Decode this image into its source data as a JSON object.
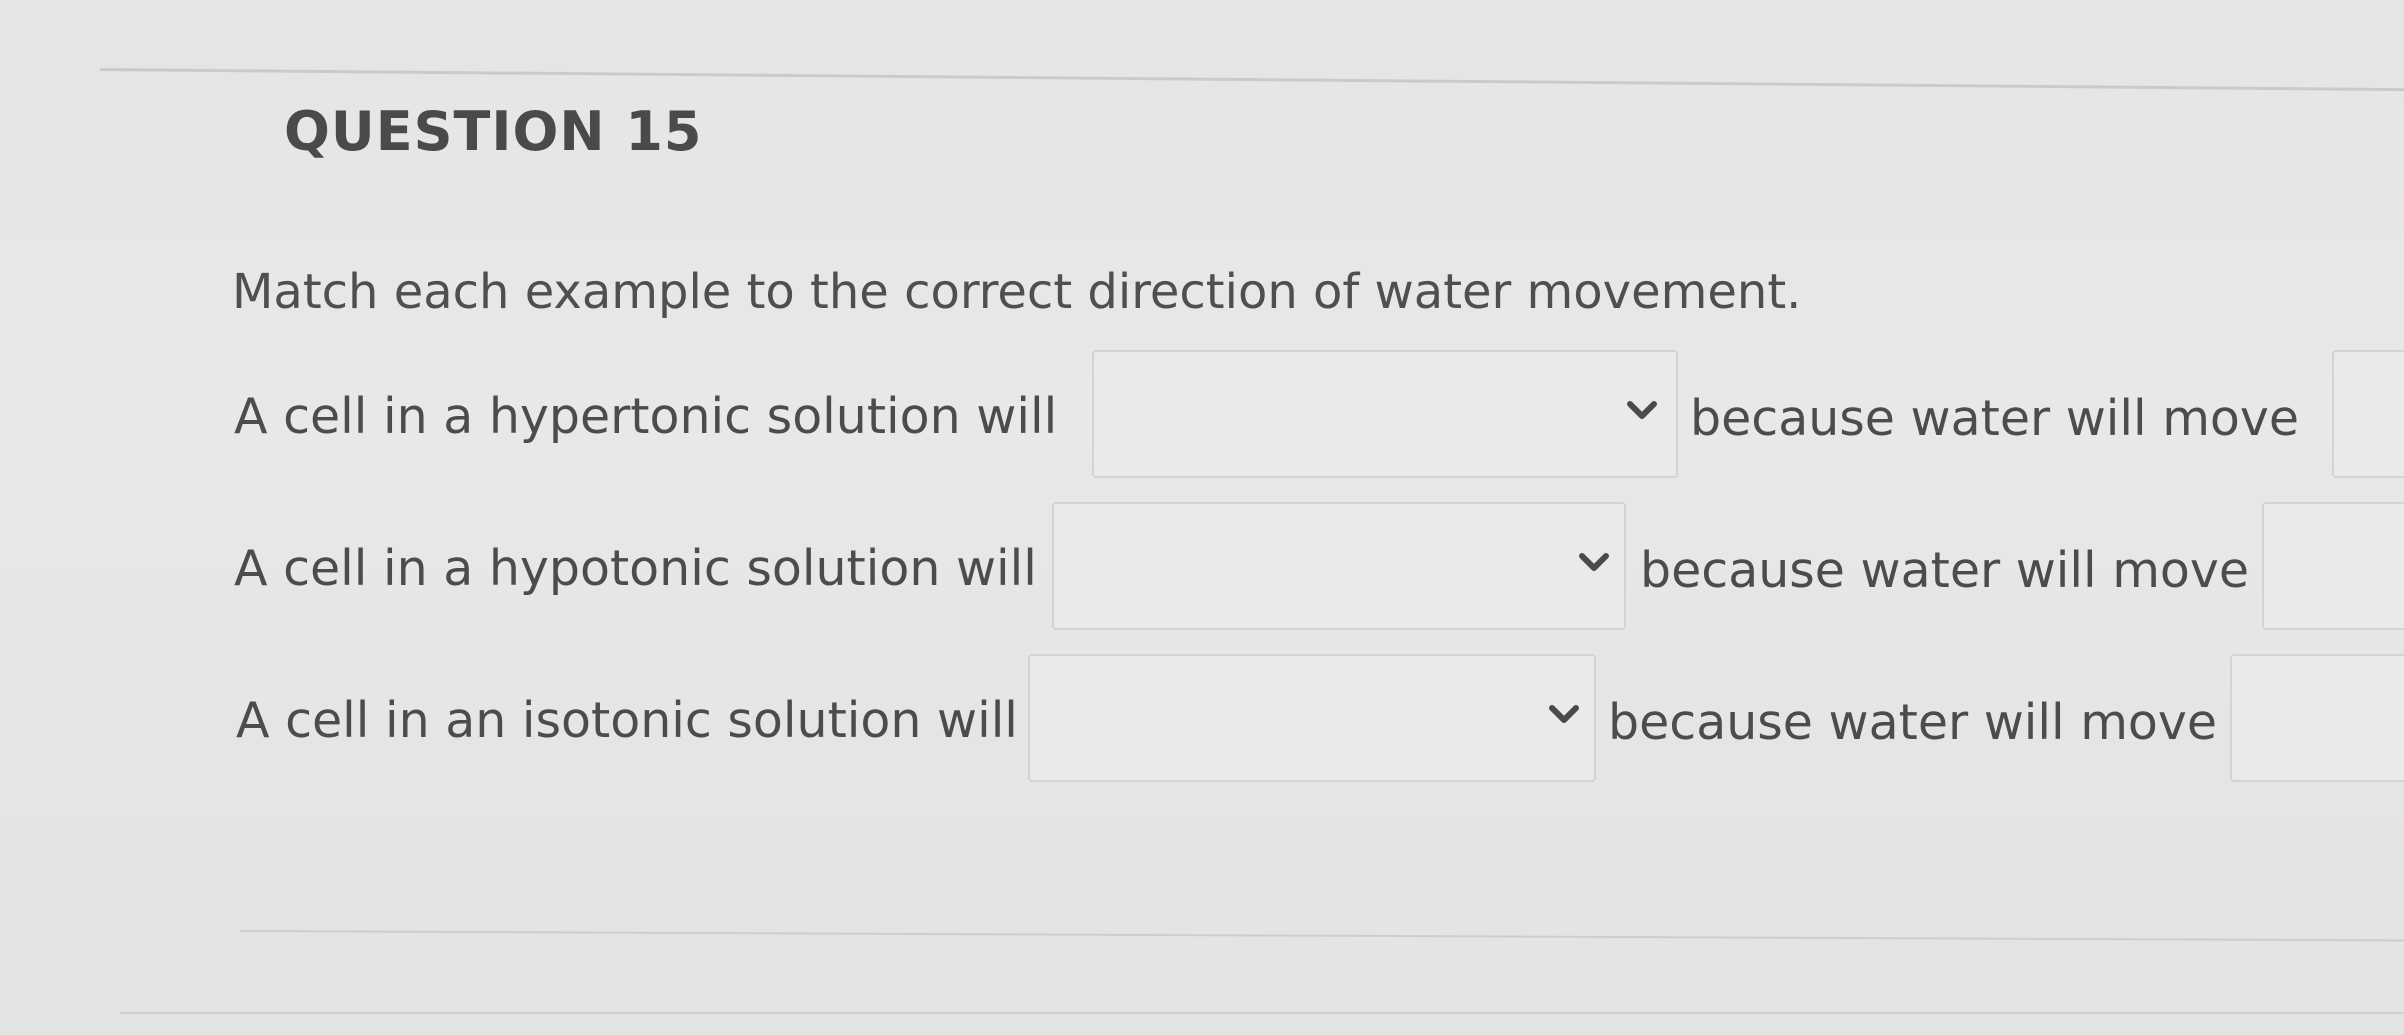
{
  "question": {
    "title": "QUESTION 15",
    "instruction": "Match each example to the correct direction of water movement."
  },
  "rows": [
    {
      "prompt": "A cell in a hypertonic solution will",
      "selected_value": "",
      "because_label": "because water will move",
      "selected_value_2": ""
    },
    {
      "prompt": "A cell in a hypotonic solution will",
      "selected_value": "",
      "because_label": "because water will move",
      "selected_value_2": ""
    },
    {
      "prompt": "A cell in an isotonic solution will",
      "selected_value": "",
      "because_label": "because water will move",
      "selected_value_2": ""
    }
  ],
  "icons": {
    "dropdown": "chevron-down-icon"
  },
  "colors": {
    "background": "#e6e7e7",
    "text": "#4c4c4c",
    "border": "#d2d4d4"
  }
}
